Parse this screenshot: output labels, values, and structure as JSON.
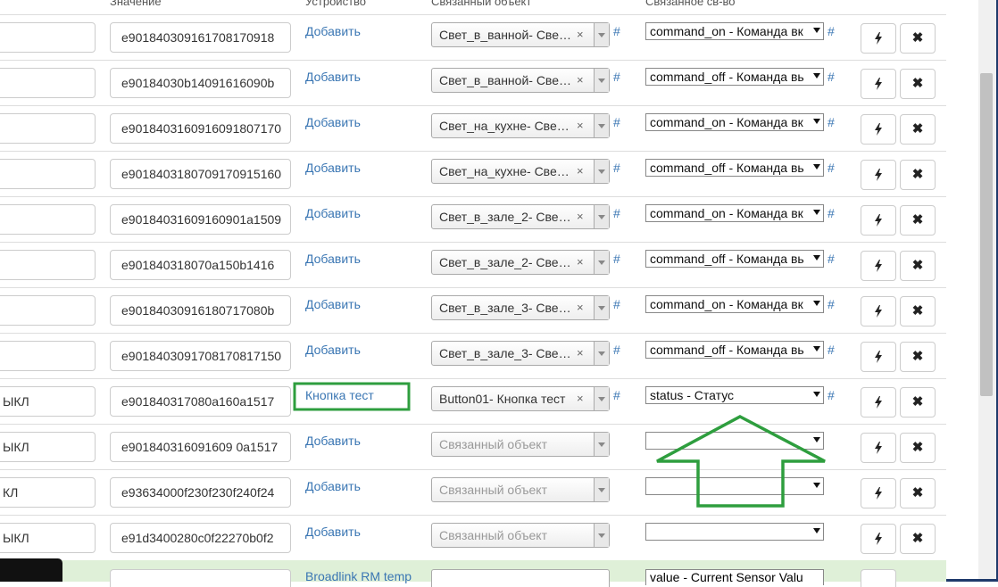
{
  "headers": {
    "value": "Значение",
    "device": "Устройство",
    "linked": "Связанный объект",
    "property": "Связанное св-во"
  },
  "rows": [
    {
      "name": "",
      "value": "e901840309161708170918",
      "device": "Добавить",
      "linked": "Свет_в_ванной- Све…",
      "linked_placeholder": false,
      "property": "command_on - Команда вк"
    },
    {
      "name": "",
      "value": "e90184030b14091616090b",
      "device": "Добавить",
      "linked": "Свет_в_ванной- Све…",
      "linked_placeholder": false,
      "property": "command_off - Команда вь"
    },
    {
      "name": "",
      "value": "e9018403160916091807170",
      "device": "Добавить",
      "linked": "Свет_на_кухне- Све…",
      "linked_placeholder": false,
      "property": "command_on - Команда вк"
    },
    {
      "name": "",
      "value": "e9018403180709170915160",
      "device": "Добавить",
      "linked": "Свет_на_кухне- Све…",
      "linked_placeholder": false,
      "property": "command_off - Команда вь"
    },
    {
      "name": "",
      "value": "e90184031609160901a1509",
      "device": "Добавить",
      "linked": "Свет_в_зале_2- Све…",
      "linked_placeholder": false,
      "property": "command_on - Команда вк"
    },
    {
      "name": "",
      "value": "e901840318070a150b1416",
      "device": "Добавить",
      "linked": "Свет_в_зале_2- Све…",
      "linked_placeholder": false,
      "property": "command_off - Команда вь"
    },
    {
      "name": "",
      "value": "e90184030916180717080b",
      "device": "Добавить",
      "linked": "Свет_в_зале_3- Све…",
      "linked_placeholder": false,
      "property": "command_on - Команда вк"
    },
    {
      "name": "",
      "value": "e9018403091708170817150",
      "device": "Добавить",
      "linked": "Свет_в_зале_3- Све…",
      "linked_placeholder": false,
      "property": "command_off - Команда вь"
    },
    {
      "name": "ЫКЛ",
      "value": "e901840317080a160a1517",
      "device": "Кнопка тест",
      "linked": "Button01- Кнопка тест",
      "linked_placeholder": false,
      "property": "status - Статус"
    },
    {
      "name": "ЫКЛ",
      "value": "e901840316091609 0a1517",
      "device": "Добавить",
      "linked": "Связанный объект",
      "linked_placeholder": true,
      "property": ""
    },
    {
      "name": "КЛ",
      "value": "e93634000f230f230f240f24",
      "device": "Добавить",
      "linked": "Связанный объект",
      "linked_placeholder": true,
      "property": ""
    },
    {
      "name": "ЫКЛ",
      "value": "e91d3400280c0f22270b0f2",
      "device": "Добавить",
      "linked": "Связанный объект",
      "linked_placeholder": true,
      "property": ""
    }
  ],
  "partial_row": {
    "device": "Broadlink RM temp",
    "property": "value - Current Sensor Valu"
  },
  "symbols": {
    "hash": "#",
    "clear": "×",
    "run_icon": "bolt-icon",
    "delete_icon": "x-icon"
  },
  "colors": {
    "link": "#3a76b3",
    "highlight_box": "#2e9e3e",
    "arrow": "#2e9e3e",
    "success_row": "#dff0d8"
  }
}
